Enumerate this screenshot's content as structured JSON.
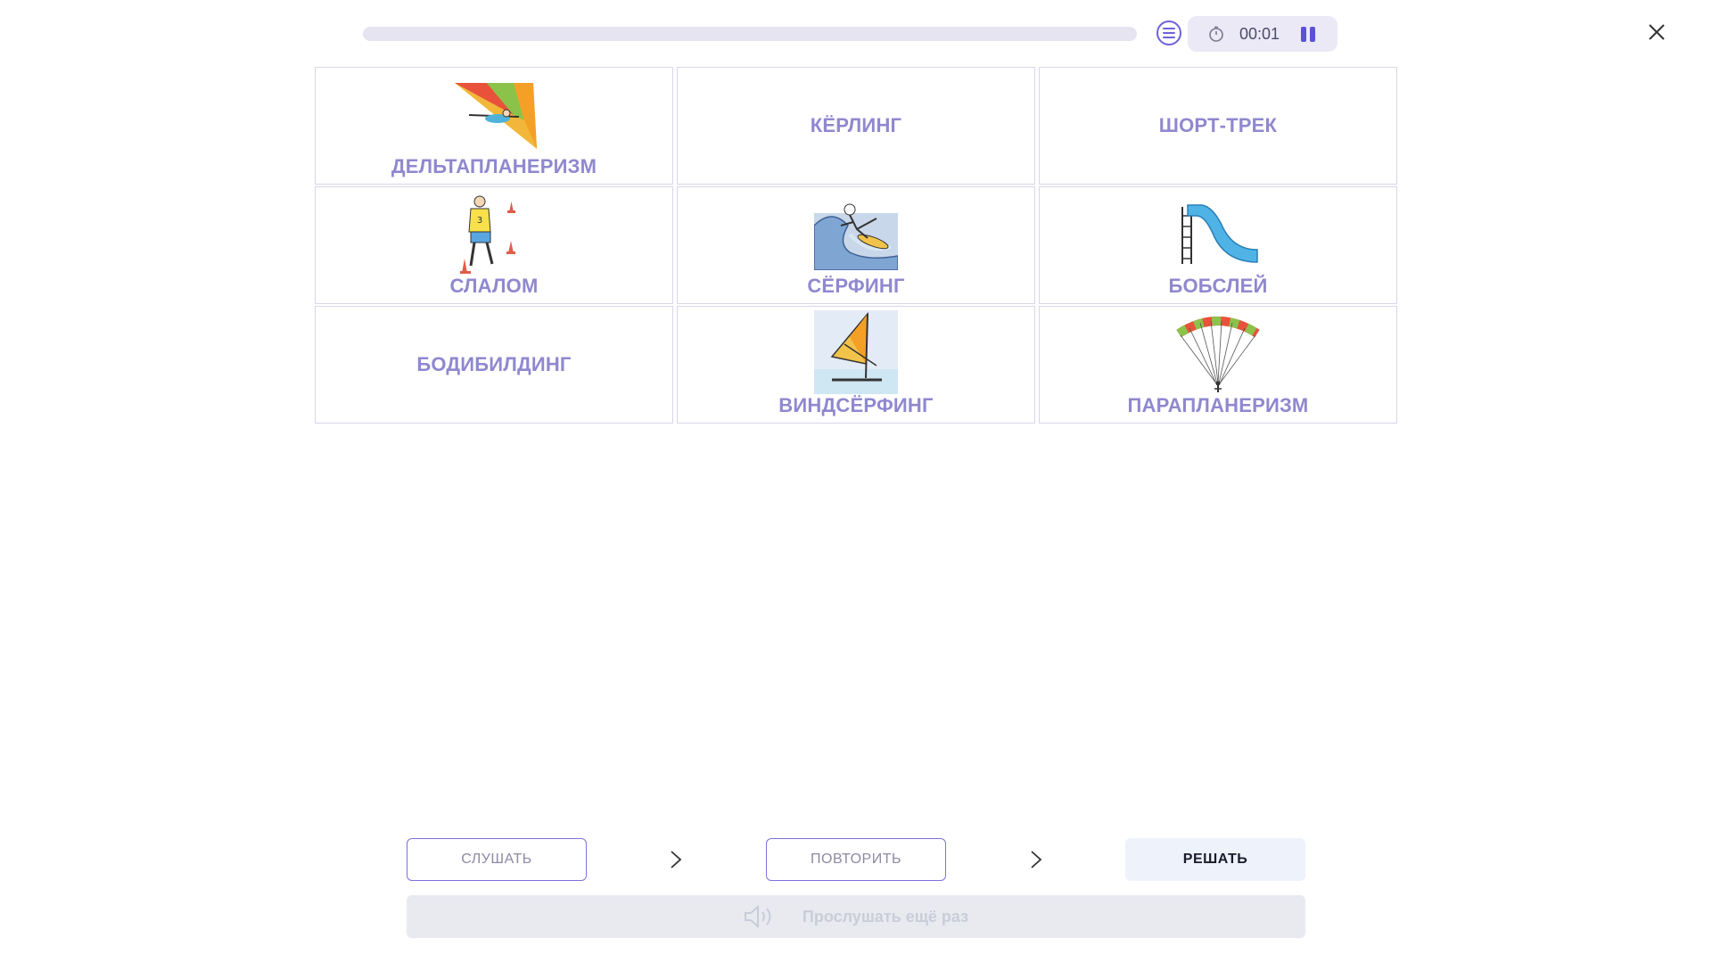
{
  "header": {
    "progress": 0.0,
    "timer": "00:01"
  },
  "cards": [
    {
      "label": "ДЕЛЬТАПЛАНЕРИЗМ",
      "icon": "hang-glider-icon"
    },
    {
      "label": "КЁРЛИНГ",
      "icon": ""
    },
    {
      "label": "ШОРТ-ТРЕК",
      "icon": ""
    },
    {
      "label": "СЛАЛОМ",
      "icon": "slalom-icon"
    },
    {
      "label": "СЁРФИНГ",
      "icon": "surfing-icon"
    },
    {
      "label": "БОБСЛЕЙ",
      "icon": "slide-icon"
    },
    {
      "label": "БОДИБИЛДИНГ",
      "icon": ""
    },
    {
      "label": "ВИНДСЁРФИНГ",
      "icon": "windsurfing-icon"
    },
    {
      "label": "ПАРАПЛАНЕРИЗМ",
      "icon": "paraglider-icon"
    }
  ],
  "steps": {
    "listen": "СЛУШАТЬ",
    "repeat": "ПОВТОРИТЬ",
    "solve": "РЕШАТЬ"
  },
  "replay": {
    "label": "Прослушать ещё раз"
  },
  "colors": {
    "accent": "#6c63d8",
    "card_label": "#8f88cf",
    "card_border": "#d9d6ea"
  }
}
